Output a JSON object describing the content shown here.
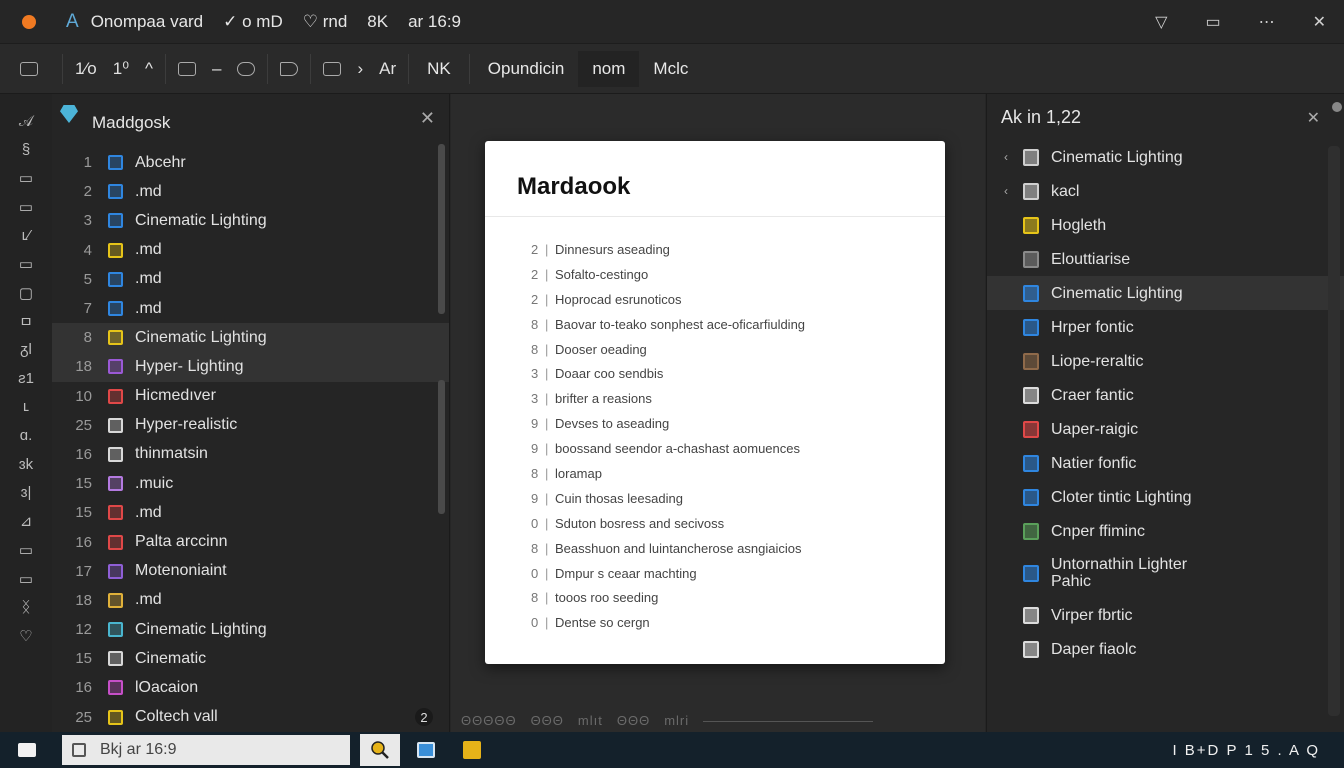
{
  "titlebar": {
    "logo": "A",
    "parts": [
      "Onompaa vard",
      "✓ o mD",
      "♡ rnd",
      "8K",
      "ar 16:9"
    ],
    "controls": [
      "▽",
      "▭",
      "⋯",
      "✕"
    ]
  },
  "toolbar": {
    "nums": [
      "1⁄o",
      "1⁰"
    ],
    "caret": "^",
    "mid": [
      "–"
    ],
    "crumb_arrow": "›",
    "crumb_label": "Ar",
    "tabs": [
      "NK",
      "Opundicin",
      "nom",
      "Mclc"
    ]
  },
  "activity_icons": [
    "𝒜",
    "§",
    "▭",
    "▭",
    "ʟ⁄",
    "▭",
    "▢",
    "ㅁ",
    "ᵹl",
    "ƨ1",
    "ʟ",
    "ɑ.",
    "ɜk",
    "ɜ|",
    "⊿",
    "▭",
    "▭",
    "ᛝ",
    "♡"
  ],
  "explorer": {
    "title": "Maddgosk",
    "close": "✕",
    "badge": "2",
    "files": [
      {
        "num": "1",
        "name": "Abcehr",
        "color": "#2f86e0"
      },
      {
        "num": "2",
        "name": ".md",
        "color": "#2f86e0"
      },
      {
        "num": "3",
        "name": "Cinematic Lighting",
        "color": "#2f86e0"
      },
      {
        "num": "4",
        "name": ".md",
        "color": "#e6c419"
      },
      {
        "num": "5",
        "name": ".md",
        "color": "#2f86e0"
      },
      {
        "num": "7",
        "name": ".md",
        "color": "#2f86e0"
      },
      {
        "num": "8",
        "name": "Cinematic Lighting",
        "color": "#e6c419"
      },
      {
        "num": "18",
        "name": "Hyper- Lighting",
        "color": "#9b59d6"
      },
      {
        "num": "10",
        "name": "Hicmedıver",
        "color": "#e04848"
      },
      {
        "num": "25",
        "name": "Hyper-realistic",
        "color": "#d8d8d8"
      },
      {
        "num": "16",
        "name": "thinmatsin",
        "color": "#d8d8d8"
      },
      {
        "num": "15",
        "name": ".muic",
        "color": "#b47ae0"
      },
      {
        "num": "15",
        "name": ".md",
        "color": "#e04848"
      },
      {
        "num": "16",
        "name": "Palta arccinn",
        "color": "#e04848"
      },
      {
        "num": "17",
        "name": "Motenoniaint",
        "color": "#8f5fd6"
      },
      {
        "num": "18",
        "name": ".md",
        "color": "#e0b13a"
      },
      {
        "num": "12",
        "name": "Cinematic Lighting",
        "color": "#4ab6cf"
      },
      {
        "num": "15",
        "name": "Cinematic",
        "color": "#d8d8d8"
      },
      {
        "num": "16",
        "name": "lOacaion",
        "color": "#c64fc8"
      },
      {
        "num": "25",
        "name": "Coltech vall",
        "color": "#e6c419"
      }
    ]
  },
  "document": {
    "title": "Mardaook",
    "lines": [
      {
        "n": "2",
        "text": "Dinnesurs aseading"
      },
      {
        "n": "2",
        "text": "Sofalto-cestingo"
      },
      {
        "n": "2",
        "text": "Hoprocad esrunoticos"
      },
      {
        "n": "8",
        "text": "Baovar to-teako sonphest ace-oficarfiulding"
      },
      {
        "n": "8",
        "text": "Dooser oeading"
      },
      {
        "n": "3",
        "text": "Doaar coo sendbis"
      },
      {
        "n": "3",
        "text": "brifter a reasions"
      },
      {
        "n": "9",
        "text": "Devses to aseading"
      },
      {
        "n": "9",
        "text": "boossand seendor a-chashast aomuences"
      },
      {
        "n": "8",
        "text": "loramap"
      },
      {
        "n": "9",
        "text": "Cuin thosas leesading"
      },
      {
        "n": "0",
        "text": "Sduton bosress and secivoss"
      },
      {
        "n": "8",
        "text": "Beasshuon and luintancherose asngiaicios"
      },
      {
        "n": "0",
        "text": "Dmpur s ceaar machting"
      },
      {
        "n": "8",
        "text": "tooos roo seeding"
      },
      {
        "n": "0",
        "text": "Dentse so cergn"
      }
    ],
    "status": [
      "ΘΘΘΘΘ",
      "ΘΘΘ",
      "mlıt",
      "ΘΘΘ",
      "mlri"
    ]
  },
  "rpanel": {
    "title": "Ak in 1,22",
    "close": "✕",
    "items": [
      {
        "caret": "‹",
        "name": "Cinematic Lighting",
        "color": "#cfcfcf"
      },
      {
        "caret": "‹",
        "name": "kacl",
        "color": "#cfcfcf"
      },
      {
        "caret": "",
        "name": "Hogleth",
        "color": "#e6c419"
      },
      {
        "caret": "",
        "name": "Elouttiarise",
        "color": "#8a8a8a"
      },
      {
        "caret": "",
        "name": "Cinematic Lighting",
        "color": "#2f86e0"
      },
      {
        "caret": "",
        "name": "Hrper fontic",
        "color": "#2f86e0"
      },
      {
        "caret": "",
        "name": "Liope-reraltic",
        "color": "#8f6a4a"
      },
      {
        "caret": "",
        "name": "Craer fantic",
        "color": "#dcdcdc"
      },
      {
        "caret": "",
        "name": "Uaper-raigic",
        "color": "#e04848"
      },
      {
        "caret": "",
        "name": "Natier fonfic",
        "color": "#2f86e0"
      },
      {
        "caret": "",
        "name": "Cloter tintic Lighting",
        "color": "#2f86e0"
      },
      {
        "caret": "",
        "name": "Cnper ffiminc",
        "color": "#5aa05a"
      },
      {
        "caret": "",
        "name": "Untornathin Lighter Pahic",
        "color": "#2f86e0"
      },
      {
        "caret": "",
        "name": "Virper fbrtic",
        "color": "#dcdcdc"
      },
      {
        "caret": "",
        "name": "Daper fiaolc",
        "color": "#dcdcdc"
      }
    ]
  },
  "taskbar": {
    "search_text": "Bkj ar 16:9",
    "tray": "I B+D P 1 5 . A Q"
  }
}
